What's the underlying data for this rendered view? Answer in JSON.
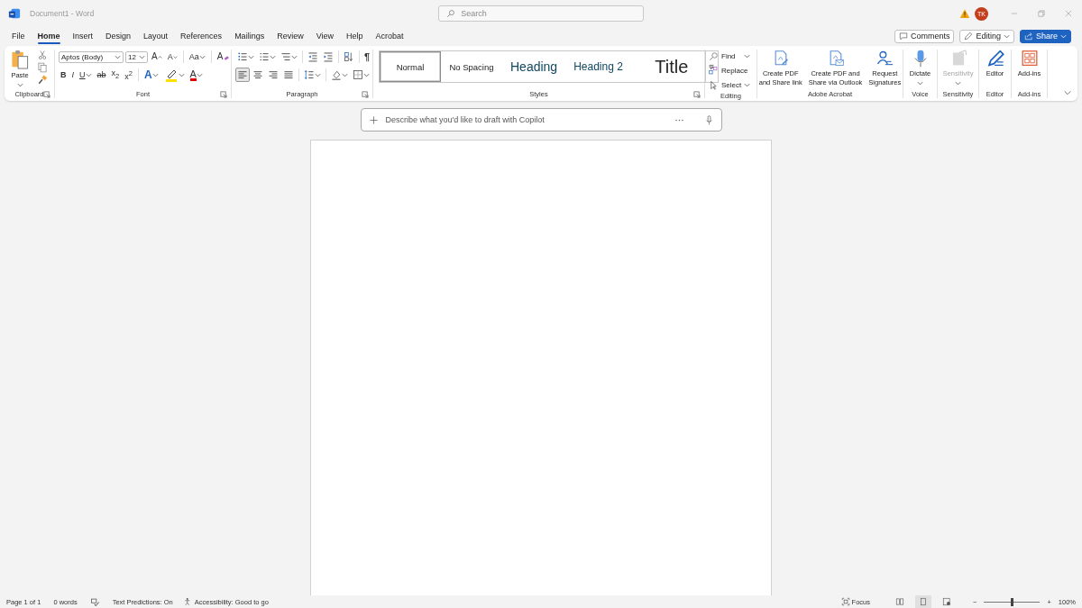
{
  "window": {
    "title": "Document1 - Word",
    "search_placeholder": "Search",
    "avatar": "TK"
  },
  "menu_tabs": [
    {
      "label": "File",
      "selected": false
    },
    {
      "label": "Home",
      "selected": true
    },
    {
      "label": "Insert",
      "selected": false
    },
    {
      "label": "Design",
      "selected": false
    },
    {
      "label": "Layout",
      "selected": false
    },
    {
      "label": "References",
      "selected": false
    },
    {
      "label": "Mailings",
      "selected": false
    },
    {
      "label": "Review",
      "selected": false
    },
    {
      "label": "View",
      "selected": false
    },
    {
      "label": "Help",
      "selected": false
    },
    {
      "label": "Acrobat",
      "selected": false
    }
  ],
  "actions": {
    "comments": "Comments",
    "editing": "Editing",
    "share": "Share"
  },
  "ribbon": {
    "clipboard": {
      "label": "Clipboard",
      "paste": "Paste"
    },
    "font": {
      "label": "Font",
      "font_name": "Aptos (Body)",
      "font_size": "12",
      "grow_font": "A",
      "shrink_font": "A",
      "change_case": "Aa",
      "clear_formatting": "A",
      "bold": "B",
      "italic": "I",
      "underline": "U",
      "strikethrough": "ab",
      "subscript": "x$_{2}$",
      "superscript": "x$^{2}$",
      "text_effects": "A",
      "font_color": "A"
    },
    "paragraph": {
      "label": "Paragraph",
      "show_marks": "¶",
      "alignments": [
        {
          "selected": true
        },
        {
          "selected": false
        },
        {
          "selected": false
        },
        {
          "selected": false
        }
      ]
    },
    "styles": {
      "label": "Styles",
      "items": [
        {
          "label": "Normal",
          "kind": "normal",
          "selected": true
        },
        {
          "label": "No Spacing",
          "kind": "normal",
          "selected": false
        },
        {
          "label": "Heading",
          "kind": "heading1",
          "selected": false
        },
        {
          "label": "Heading 2",
          "kind": "heading2",
          "selected": false
        },
        {
          "label": "Title",
          "kind": "title",
          "selected": false
        }
      ]
    },
    "editing": {
      "label": "Editing",
      "find": "Find",
      "replace": "Replace",
      "select": "Select"
    },
    "acrobat": {
      "label": "Adobe Acrobat",
      "items": [
        {
          "lines": [
            "Create PDF",
            "and Share link"
          ]
        },
        {
          "lines": [
            "Create PDF and",
            "Share via Outlook"
          ]
        },
        {
          "lines": [
            "Request",
            "Signatures"
          ]
        }
      ]
    },
    "voice": {
      "label": "Voice",
      "button": "Dictate"
    },
    "sensitivity": {
      "label": "Sensitivity",
      "button": "Sensitivity",
      "disabled": true
    },
    "editor": {
      "label": "Editor",
      "button": "Editor"
    },
    "addins": {
      "label": "Add-ins",
      "button": "Add-ins"
    }
  },
  "copilot": {
    "placeholder": "Describe what you'd like to draft with Copilot"
  },
  "status_bar": {
    "page": "Page 1 of 1",
    "words": "0 words",
    "text_predictions": "Text Predictions: On",
    "accessibility": "Accessibility: Good to go",
    "focus": "Focus",
    "views": [
      {
        "selected": false
      },
      {
        "selected": true
      },
      {
        "selected": false
      }
    ],
    "zoom_out": "−",
    "zoom_in": "+",
    "zoom": {
      "level": 0.5
    },
    "zoom_percent": "100%"
  }
}
